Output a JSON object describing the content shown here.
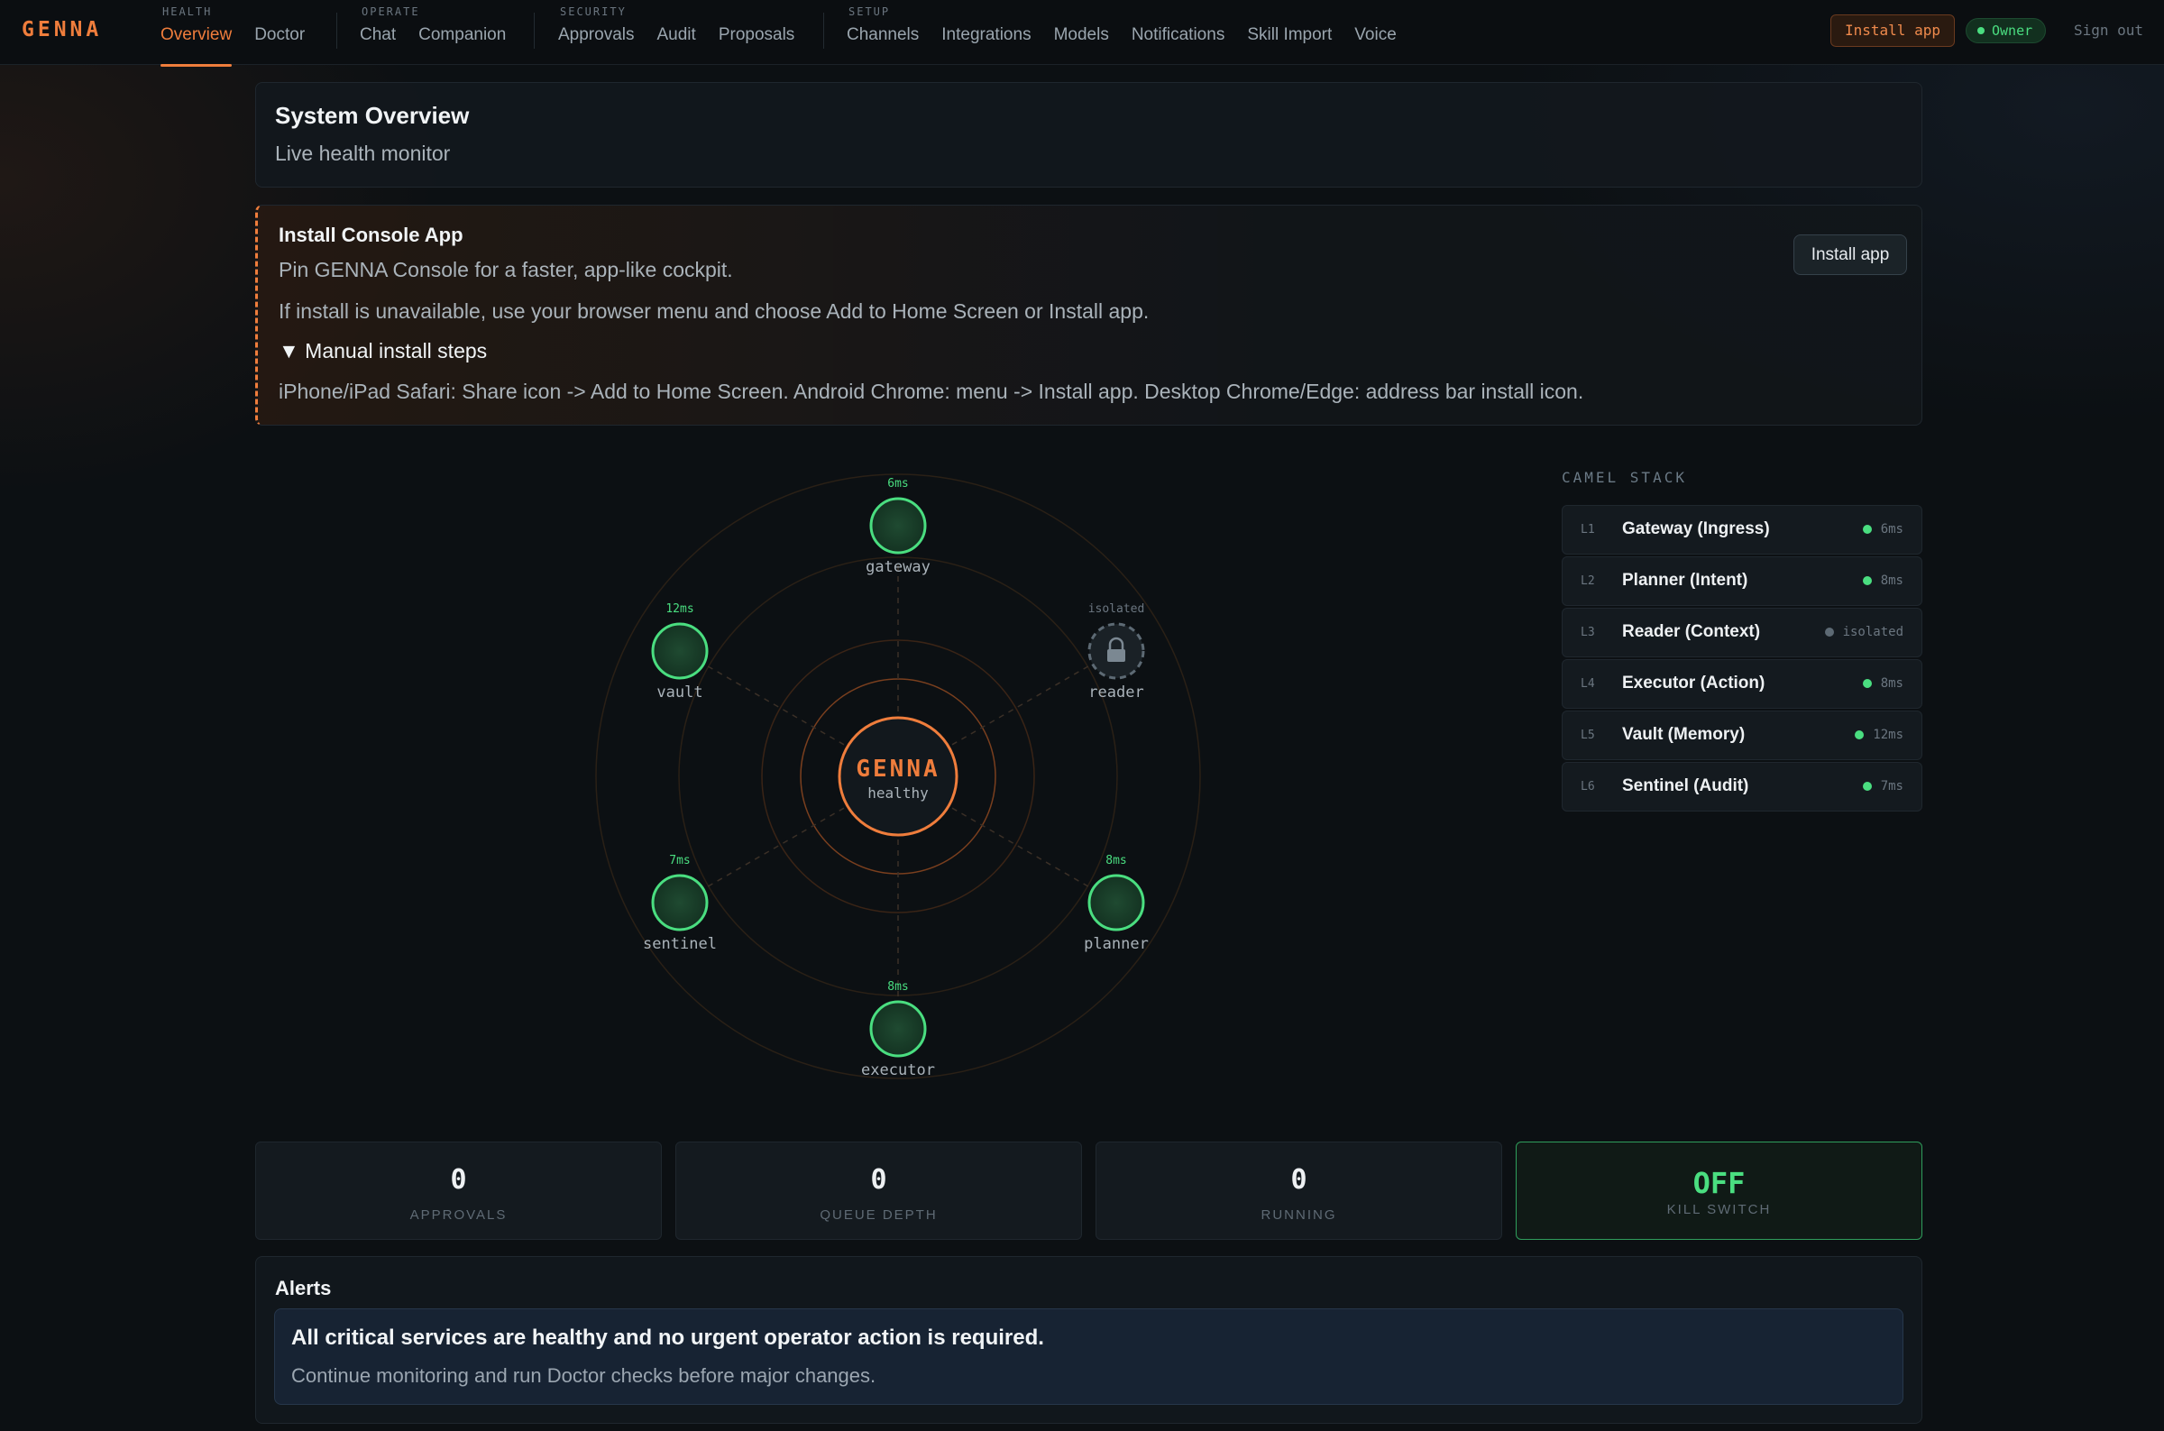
{
  "brand": "GENNA",
  "nav": {
    "groups": [
      {
        "label": "HEALTH",
        "items": [
          "Overview",
          "Doctor"
        ]
      },
      {
        "label": "OPERATE",
        "items": [
          "Chat",
          "Companion"
        ]
      },
      {
        "label": "SECURITY",
        "items": [
          "Approvals",
          "Audit",
          "Proposals"
        ]
      },
      {
        "label": "SETUP",
        "items": [
          "Channels",
          "Integrations",
          "Models",
          "Notifications",
          "Skill Import",
          "Voice"
        ]
      }
    ],
    "active_item": "Overview",
    "install_label": "Install app",
    "owner_label": "Owner",
    "signout_label": "Sign out"
  },
  "overview": {
    "title": "System Overview",
    "subtitle": "Live health monitor"
  },
  "install": {
    "title": "Install Console App",
    "line1": "Pin GENNA Console for a faster, app-like cockpit.",
    "line2": "If install is unavailable, use your browser menu and choose Add to Home Screen or Install app.",
    "steps_toggle": "▼ Manual install steps",
    "steps_text": "iPhone/iPad Safari: Share icon -> Add to Home Screen. Android Chrome: menu -> Install app. Desktop Chrome/Edge: address bar install icon.",
    "button_label": "Install app"
  },
  "core": {
    "name": "GENNA",
    "status": "healthy"
  },
  "nodes": {
    "gateway": {
      "label": "gateway",
      "latency": "6ms",
      "status": "healthy"
    },
    "reader": {
      "label": "reader",
      "latency": "isolated",
      "status": "isolated"
    },
    "planner": {
      "label": "planner",
      "latency": "8ms",
      "status": "healthy"
    },
    "executor": {
      "label": "executor",
      "latency": "8ms",
      "status": "healthy"
    },
    "sentinel": {
      "label": "sentinel",
      "latency": "7ms",
      "status": "healthy"
    },
    "vault": {
      "label": "vault",
      "latency": "12ms",
      "status": "healthy"
    }
  },
  "camel_stack": {
    "title": "CAMEL STACK",
    "rows": [
      {
        "level": "L1",
        "name": "Gateway (Ingress)",
        "status": "6ms",
        "ok": true
      },
      {
        "level": "L2",
        "name": "Planner (Intent)",
        "status": "8ms",
        "ok": true
      },
      {
        "level": "L3",
        "name": "Reader (Context)",
        "status": "isolated",
        "ok": false
      },
      {
        "level": "L4",
        "name": "Executor (Action)",
        "status": "8ms",
        "ok": true
      },
      {
        "level": "L5",
        "name": "Vault (Memory)",
        "status": "12ms",
        "ok": true
      },
      {
        "level": "L6",
        "name": "Sentinel (Audit)",
        "status": "7ms",
        "ok": true
      }
    ]
  },
  "stats": {
    "approvals": {
      "value": "0",
      "label": "APPROVALS"
    },
    "queue_depth": {
      "value": "0",
      "label": "QUEUE DEPTH"
    },
    "running": {
      "value": "0",
      "label": "RUNNING"
    },
    "kill_switch": {
      "value": "OFF",
      "label": "KILL SWITCH"
    }
  },
  "alerts": {
    "title": "Alerts",
    "headline": "All critical services are healthy and no urgent operator action is required.",
    "body": "Continue monitoring and run Doctor checks before major changes."
  },
  "colors": {
    "accent": "#ef7d3c",
    "healthy": "#4ade80",
    "isolated": "#5d6a74"
  }
}
